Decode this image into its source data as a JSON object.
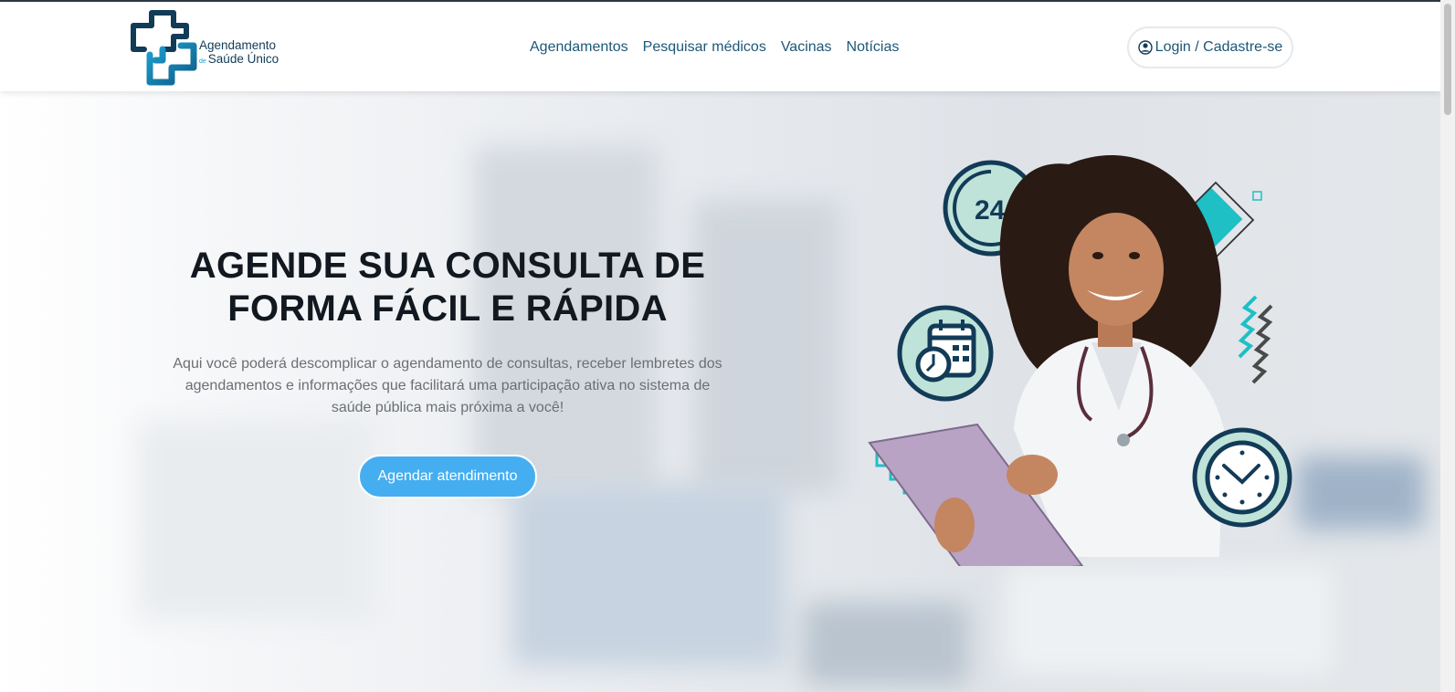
{
  "brand": {
    "name_line1": "Agendamento",
    "name_de": "de",
    "name_line2": "Saúde Único"
  },
  "nav": {
    "items": [
      {
        "label": "Agendamentos"
      },
      {
        "label": "Pesquisar médicos"
      },
      {
        "label": "Vacinas"
      },
      {
        "label": "Notícias"
      }
    ]
  },
  "auth": {
    "login_label": "Login / Cadastre-se",
    "icon": "user-circle-icon"
  },
  "hero": {
    "title_line1": "AGENDE SUA CONSULTA DE",
    "title_line2": "FORMA FÁCIL E RÁPIDA",
    "description": "Aqui você poderá descomplicar o agendamento de consultas, receber lembretes dos agendamentos e informações que facilitará uma participação ativa no sistema de saúde pública mais próxima a você!",
    "cta_label": "Agendar atendimento",
    "badge_24": "24"
  },
  "colors": {
    "primary_dark": "#123b57",
    "nav_text": "#1d5777",
    "cta_bg": "#44aef0",
    "accent_teal": "#1fbfc6",
    "mint": "#bfe3d9"
  }
}
